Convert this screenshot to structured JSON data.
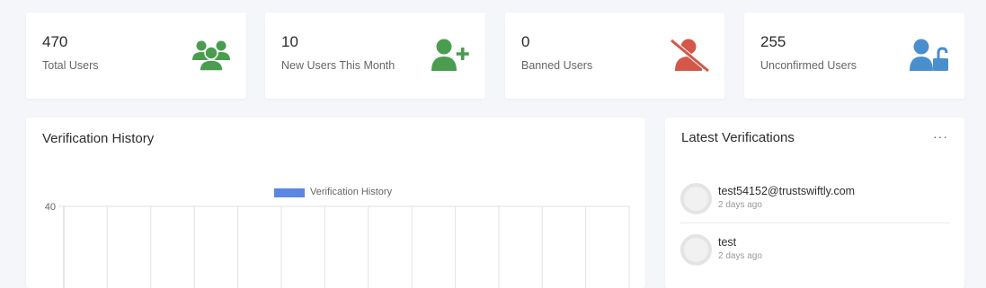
{
  "stats": [
    {
      "value": "470",
      "label": "Total Users",
      "icon": "users-group-icon",
      "color": "#4a9d4f"
    },
    {
      "value": "10",
      "label": "New Users This Month",
      "icon": "user-plus-icon",
      "color": "#4a9d4f"
    },
    {
      "value": "0",
      "label": "Banned Users",
      "icon": "user-slash-icon",
      "color": "#d4574a"
    },
    {
      "value": "255",
      "label": "Unconfirmed Users",
      "icon": "user-unlock-icon",
      "color": "#4a8fcd"
    }
  ],
  "verification_history": {
    "title": "Verification History"
  },
  "latest_verifications": {
    "title": "Latest Verifications",
    "more_label": "···",
    "items": [
      {
        "email": "test54152@trustswiftly.com",
        "time": "2 days ago"
      },
      {
        "email": "test",
        "time": "2 days ago"
      }
    ]
  },
  "chart_data": {
    "type": "line",
    "title": "",
    "legend": [
      "Verification History"
    ],
    "series": [
      {
        "name": "Verification History",
        "values": []
      }
    ],
    "y_ticks": [
      "40"
    ],
    "grid": true,
    "legend_placement": "top-center"
  }
}
